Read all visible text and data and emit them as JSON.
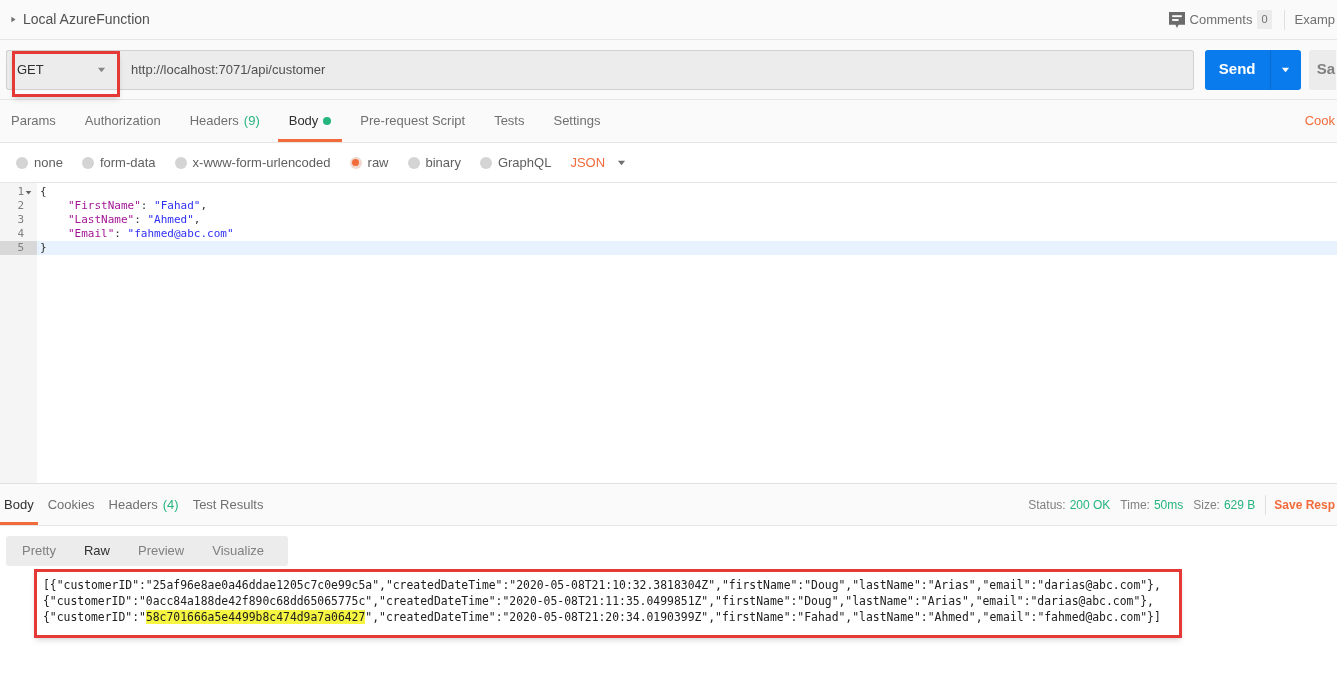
{
  "header": {
    "title": "Local AzureFunction",
    "comments": {
      "label": "Comments",
      "count": "0"
    },
    "examples": "Examp"
  },
  "request": {
    "method": "GET",
    "url": "http://localhost:7071/api/customer",
    "send": "Send",
    "save": "Sa"
  },
  "tabs": [
    {
      "label": "Params",
      "dot": false,
      "selected": false
    },
    {
      "label": "Authorization",
      "dot": false,
      "selected": false
    },
    {
      "label": "Headers",
      "count": "(9)",
      "dot": false,
      "selected": false
    },
    {
      "label": "Body",
      "dot": true,
      "selected": true
    },
    {
      "label": "Pre-request Script",
      "dot": false,
      "selected": false
    },
    {
      "label": "Tests",
      "dot": false,
      "selected": false
    },
    {
      "label": "Settings",
      "dot": false,
      "selected": false
    }
  ],
  "cookies_link": "Cook",
  "body_types": [
    {
      "label": "none",
      "selected": false
    },
    {
      "label": "form-data",
      "selected": false
    },
    {
      "label": "x-www-form-urlencoded",
      "selected": false
    },
    {
      "label": "raw",
      "selected": true
    },
    {
      "label": "binary",
      "selected": false
    },
    {
      "label": "GraphQL",
      "selected": false
    }
  ],
  "format": "JSON",
  "editor_lines": [
    {
      "number": "1",
      "foldable": true,
      "current": false,
      "tokens": [
        {
          "kind": "punct",
          "text": "{"
        }
      ]
    },
    {
      "number": "2",
      "foldable": false,
      "current": false,
      "tokens": [
        {
          "kind": "key",
          "text": "\"FirstName\""
        },
        {
          "kind": "punct",
          "text": ": "
        },
        {
          "kind": "string",
          "text": "\"Fahad\""
        },
        {
          "kind": "punct",
          "text": ","
        }
      ]
    },
    {
      "number": "3",
      "foldable": false,
      "current": false,
      "tokens": [
        {
          "kind": "key",
          "text": "\"LastName\""
        },
        {
          "kind": "punct",
          "text": ": "
        },
        {
          "kind": "string",
          "text": "\"Ahmed\""
        },
        {
          "kind": "punct",
          "text": ","
        }
      ]
    },
    {
      "number": "4",
      "foldable": false,
      "current": false,
      "tokens": [
        {
          "kind": "key",
          "text": "\"Email\""
        },
        {
          "kind": "punct",
          "text": ": "
        },
        {
          "kind": "string",
          "text": "\"fahmed@abc.com\""
        }
      ]
    },
    {
      "number": "5",
      "foldable": false,
      "current": true,
      "tokens": [
        {
          "kind": "punct",
          "text": "}"
        }
      ]
    }
  ],
  "response_tabs": [
    {
      "label": "Body",
      "selected": true
    },
    {
      "label": "Cookies",
      "selected": false
    },
    {
      "label": "Headers",
      "count": "(4)",
      "selected": false
    },
    {
      "label": "Test Results",
      "selected": false
    }
  ],
  "response_meta": [
    {
      "label": "Status:",
      "value": "200 OK"
    },
    {
      "label": "Time:",
      "value": "50ms"
    },
    {
      "label": "Size:",
      "value": "629 B"
    }
  ],
  "save_response": "Save Resp",
  "view_modes": [
    {
      "label": "Pretty",
      "selected": false
    },
    {
      "label": "Raw",
      "selected": true
    },
    {
      "label": "Preview",
      "selected": false
    },
    {
      "label": "Visualize",
      "selected": false
    }
  ],
  "response_lines": [
    {
      "segments": [
        {
          "text": "[{\"customerID\":\"25af96e8ae0a46ddae1205c7c0e99c5a\",\"createdDateTime\":\"2020-05-08T21:10:32.3818304Z\",\"firstName\":\"Doug\",\"lastName\":\"Arias\",\"email\":\"darias@abc.com\"},",
          "highlighted": false
        }
      ]
    },
    {
      "segments": [
        {
          "text": "{\"customerID\":\"0acc84a188de42f890c68dd65065775c\",\"createdDateTime\":\"2020-05-08T21:11:35.0499851Z\",\"firstName\":\"Doug\",\"lastName\":\"Arias\",\"email\":\"darias@abc.com\"},",
          "highlighted": false
        }
      ]
    },
    {
      "segments": [
        {
          "text": "{\"customerID\":\"",
          "highlighted": false
        },
        {
          "text": "58c701666a5e4499b8c474d9a7a06427",
          "highlighted": true
        },
        {
          "text": "\",\"createdDateTime\":\"2020-05-08T21:20:34.0190399Z\",\"firstName\":\"Fahad\",\"lastName\":\"Ahmed\",\"email\":\"fahmed@abc.com\"}]",
          "highlighted": false
        }
      ]
    }
  ]
}
